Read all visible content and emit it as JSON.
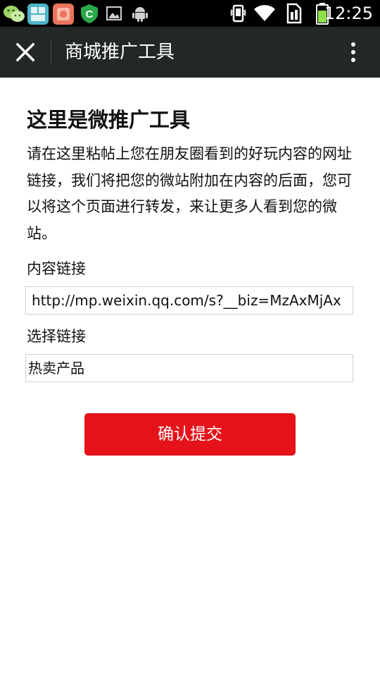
{
  "status_bar": {
    "time": "12:25",
    "notification_icons": [
      "wechat-icon",
      "gallery-app-icon",
      "launcher-app-icon",
      "security-app-icon",
      "image-icon",
      "android-icon"
    ],
    "system_icons": [
      "vibrate-icon",
      "wifi-icon",
      "sim-icon",
      "battery-icon"
    ]
  },
  "app_bar": {
    "title": "商城推广工具",
    "close_icon": "close-icon",
    "more_icon": "more-vertical-icon"
  },
  "main": {
    "title": "这里是微推广工具",
    "intro": "请在这里粘帖上您在朋友圈看到的好玩内容的网址链接，我们将把您的微站附加在内容的后面，您可以将这个页面进行转发，来让更多人看到您的微站。",
    "content_link": {
      "label": "内容链接",
      "value": "http://mp.weixin.qq.com/s?__biz=MzAxMjAx"
    },
    "select_link": {
      "label": "选择链接",
      "value": "热卖产品"
    },
    "submit_label": "确认提交"
  },
  "colors": {
    "status_bar_bg": "#000000",
    "app_bar_bg": "#232728",
    "submit_bg": "#e5121a",
    "field_border": "#cfcfcf"
  }
}
